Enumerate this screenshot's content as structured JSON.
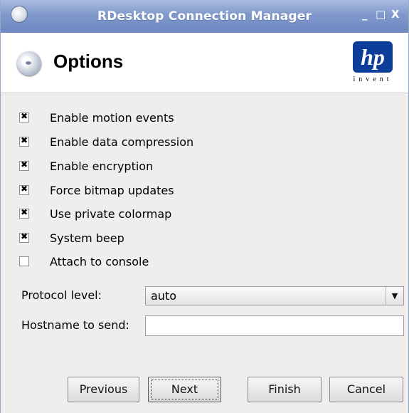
{
  "window": {
    "title": "RDesktop Connection Manager",
    "minimize": "_",
    "maximize": "□",
    "close": "X"
  },
  "header": {
    "title": "Options",
    "logo_text": "hp",
    "logo_tagline": "invent",
    "brand_color": "#0d3e99"
  },
  "options": [
    {
      "label": "Enable motion events",
      "checked": true
    },
    {
      "label": "Enable data compression",
      "checked": true
    },
    {
      "label": "Enable encryption",
      "checked": true
    },
    {
      "label": "Force bitmap updates",
      "checked": true
    },
    {
      "label": "Use private colormap",
      "checked": true
    },
    {
      "label": "System beep",
      "checked": true
    },
    {
      "label": "Attach to console",
      "checked": false
    }
  ],
  "protocol": {
    "label": "Protocol level:",
    "value": "auto"
  },
  "hostname": {
    "label": "Hostname to send:",
    "value": ""
  },
  "buttons": {
    "previous": "Previous",
    "next": "Next",
    "finish": "Finish",
    "cancel": "Cancel"
  }
}
